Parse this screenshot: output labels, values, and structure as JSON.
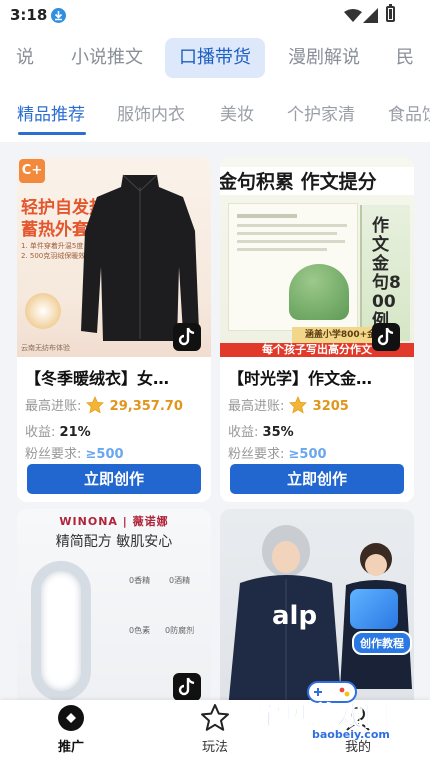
{
  "status_bar": {
    "time": "3:18"
  },
  "top_tabs": [
    {
      "label": "说",
      "active": false
    },
    {
      "label": "小说推文",
      "active": false
    },
    {
      "label": "口播带货",
      "active": true
    },
    {
      "label": "漫剧解说",
      "active": false
    },
    {
      "label": "民",
      "active": false
    }
  ],
  "sub_tabs": [
    {
      "label": "精品推荐",
      "active": true
    },
    {
      "label": "服饰内衣",
      "active": false
    },
    {
      "label": "美妆",
      "active": false
    },
    {
      "label": "个护家清",
      "active": false
    },
    {
      "label": "食品饮",
      "active": false
    }
  ],
  "labels": {
    "max_income": "最高进账:",
    "income": "收益:",
    "fans_req": "粉丝要求:",
    "create": "立即创作"
  },
  "cards": [
    {
      "title": "【冬季暖绒衣】女…",
      "max_income": "29,357.70",
      "rate": "21%",
      "fans": "≥500",
      "img": {
        "badge": "C+",
        "headline_1": "轻护自发热",
        "headline_2": "蓄热外套",
        "note_1": "1. 单件穿着升温5度",
        "note_2": "2. 500克羽绒保暖效果",
        "foot": "云南无纺布体验"
      }
    },
    {
      "title": "【时光学】作文金…",
      "max_income": "3205",
      "rate": "35%",
      "fans": "≥500",
      "img": {
        "headline": "金句积累 作文提分",
        "vertical": "作文金句800例",
        "banner": "涵盖小学800+金句",
        "bottom": "每个孩子写出高分作文"
      }
    },
    {
      "img": {
        "brand": "WINONA | 薇诺娜",
        "slogan": "精简配方 敏肌安心",
        "tags": [
          "0香精",
          "0酒精",
          "0色素",
          "0防腐剂"
        ]
      }
    },
    {
      "img": {
        "logo": "alp",
        "badge": "创作教程"
      }
    }
  ],
  "bottom_nav": [
    {
      "label": "推广",
      "icon": "promote-icon",
      "active": true
    },
    {
      "label": "玩法",
      "icon": "star-icon",
      "active": false
    },
    {
      "label": "我的",
      "icon": "profile-icon",
      "active": false
    }
  ],
  "watermark": {
    "text": "宝贝游戏网",
    "url": "baobeiy.com"
  },
  "colors": {
    "accent": "#2267d0",
    "gold": "#e0961c",
    "tab_active_bg": "#dde9fb"
  }
}
